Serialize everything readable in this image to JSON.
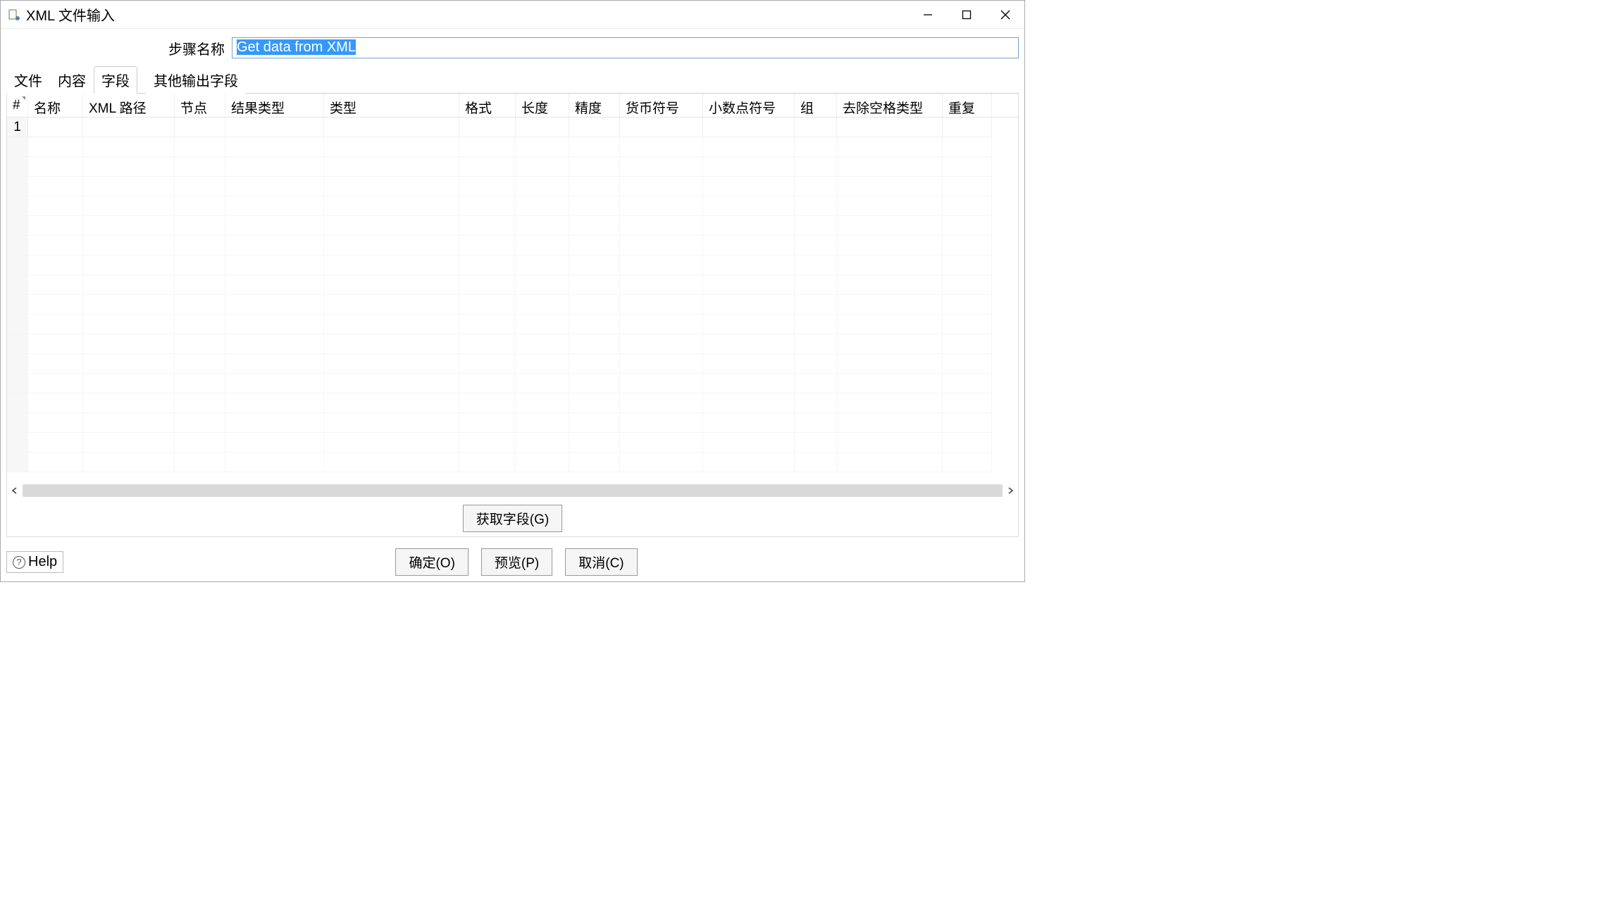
{
  "window": {
    "title": "XML 文件输入"
  },
  "stepName": {
    "label": "步骤名称",
    "value": "Get data from XML"
  },
  "tabs": {
    "file": "文件",
    "content": "内容",
    "fields": "字段",
    "otherOutput": "其他输出字段"
  },
  "columns": {
    "num": "#",
    "name": "名称",
    "xmlPath": "XML 路径",
    "node": "节点",
    "resultType": "结果类型",
    "type": "类型",
    "format": "格式",
    "length": "长度",
    "precision": "精度",
    "currency": "货币符号",
    "decimal": "小数点符号",
    "group": "组",
    "trimType": "去除空格类型",
    "repeat": "重复"
  },
  "rows": [
    {
      "num": "1",
      "name": "",
      "xmlPath": "",
      "node": "",
      "resultType": "",
      "type": "",
      "format": "",
      "length": "",
      "precision": "",
      "currency": "",
      "decimal": "",
      "group": "",
      "trimType": "",
      "repeat": ""
    }
  ],
  "buttons": {
    "getFields": "获取字段(G)",
    "ok": "确定(O)",
    "preview": "预览(P)",
    "cancel": "取消(C)",
    "help": "Help"
  }
}
